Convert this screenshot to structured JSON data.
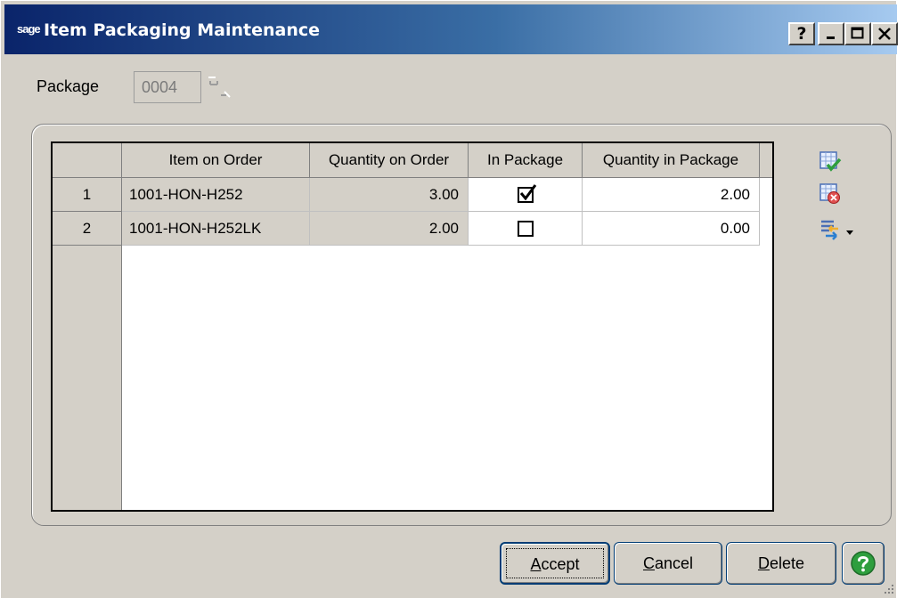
{
  "window": {
    "title": "Item Packaging Maintenance",
    "logo_text": "sage",
    "help_btn": "?",
    "min_btn": "_",
    "max_btn": "□",
    "close_btn": "×"
  },
  "form": {
    "package_label": "Package",
    "package_value": "0004"
  },
  "grid": {
    "columns": [
      "Item on Order",
      "Quantity on Order",
      "In Package",
      "Quantity in Package"
    ],
    "rows": [
      {
        "num": "1",
        "item": "1001-HON-H252",
        "qty_order": "3.00",
        "in_package": true,
        "qty_package": "2.00"
      },
      {
        "num": "2",
        "item": "1001-HON-H252LK",
        "qty_order": "2.00",
        "in_package": false,
        "qty_package": "0.00"
      }
    ]
  },
  "buttons": {
    "accept_pre": "",
    "accept_ul": "A",
    "accept_post": "ccept",
    "cancel_pre": "",
    "cancel_ul": "C",
    "cancel_post": "ancel",
    "delete_pre": "",
    "delete_ul": "D",
    "delete_post": "elete"
  },
  "icons": {
    "select_all": "select-all-icon",
    "clear_all": "clear-all-icon",
    "options": "options-icon",
    "help": "help-icon"
  },
  "colors": {
    "title_start": "#0a246a",
    "title_end": "#a6caf0",
    "window_bg": "#d4d0c8",
    "help_green": "#2e9e3e"
  }
}
